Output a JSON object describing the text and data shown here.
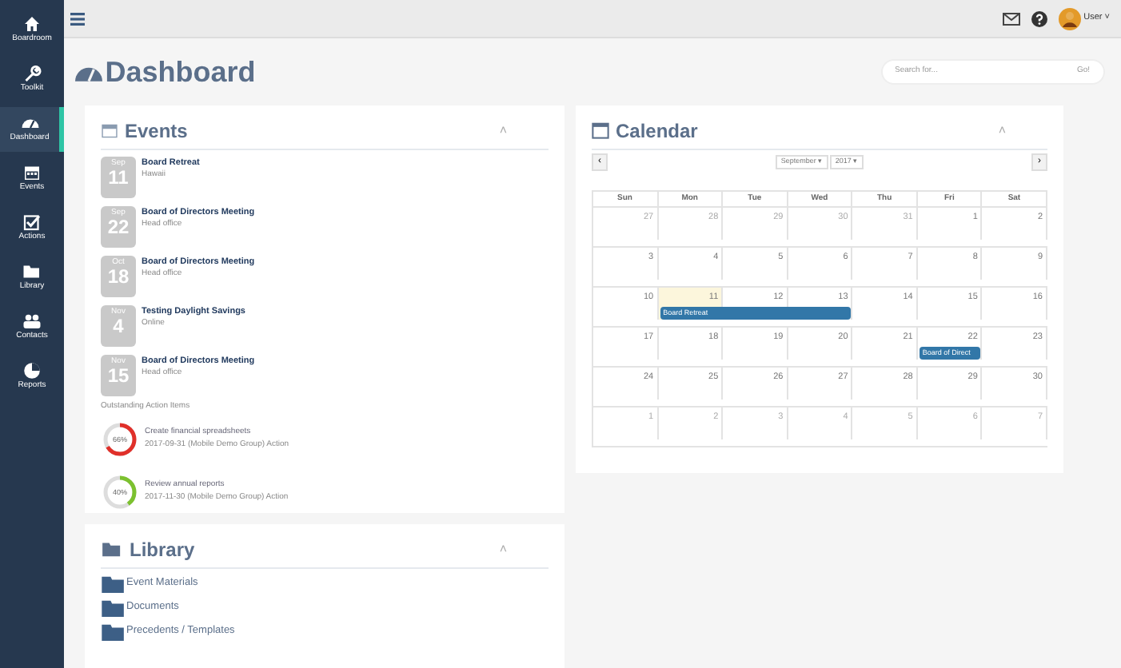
{
  "sidebar": {
    "items": [
      {
        "label": "Boardroom",
        "selected": false
      },
      {
        "label": "Toolkit",
        "selected": false
      },
      {
        "label": "Dashboard",
        "selected": true
      },
      {
        "label": "Events",
        "selected": false
      },
      {
        "label": "Actions",
        "selected": false
      },
      {
        "label": "Library",
        "selected": false
      },
      {
        "label": "Contacts",
        "selected": false
      },
      {
        "label": "Reports",
        "selected": false
      }
    ]
  },
  "topbar": {
    "user": "User",
    "caret": "˅"
  },
  "page": {
    "title": "Dashboard",
    "search": {
      "placeholder": "Search for...",
      "button": "Go!"
    }
  },
  "events": {
    "title": "Events",
    "collapse": "˄",
    "items": [
      {
        "month": "Sep",
        "day": "11",
        "title": "Board Retreat",
        "location": "Hawaii"
      },
      {
        "month": "Sep",
        "day": "22",
        "title": "Board of Directors Meeting",
        "location": "Head office"
      },
      {
        "month": "Oct",
        "day": "18",
        "title": "Board of Directors Meeting",
        "location": "Head office"
      },
      {
        "month": "Nov",
        "day": "4",
        "title": "Testing Daylight Savings",
        "location": "Online"
      },
      {
        "month": "Nov",
        "day": "15",
        "title": "Board of Directors Meeting",
        "location": "Head office"
      }
    ],
    "actions_heading": "Outstanding Action Items",
    "actions": [
      {
        "percent": "66%",
        "level": 0.66,
        "color": "#e0302a",
        "title": "Create financial spreadsheets",
        "detail": "2017-09-31 (Mobile Demo Group) Action"
      },
      {
        "percent": "40%",
        "level": 0.4,
        "color": "#7cc12f",
        "title": "Review annual reports",
        "detail": "2017-11-30 (Mobile Demo Group) Action"
      }
    ]
  },
  "calendar": {
    "title": "Calendar",
    "collapse": "˄",
    "prev": "‹",
    "next": "›",
    "month": "September ▾",
    "year": "2017 ▾",
    "weekdays": [
      "Sun",
      "Mon",
      "Tue",
      "Wed",
      "Thu",
      "Fri",
      "Sat"
    ],
    "weeks": [
      {
        "days": [
          {
            "n": "27",
            "outside": true,
            "today": false
          },
          {
            "n": "28",
            "outside": true,
            "today": false
          },
          {
            "n": "29",
            "outside": true,
            "today": false
          },
          {
            "n": "30",
            "outside": true,
            "today": false
          },
          {
            "n": "31",
            "outside": true,
            "today": false
          },
          {
            "n": "1",
            "outside": false,
            "today": false
          },
          {
            "n": "2",
            "outside": false,
            "today": false
          }
        ]
      },
      {
        "days": [
          {
            "n": "3",
            "outside": false,
            "today": false
          },
          {
            "n": "4",
            "outside": false,
            "today": false
          },
          {
            "n": "5",
            "outside": false,
            "today": false
          },
          {
            "n": "6",
            "outside": false,
            "today": false
          },
          {
            "n": "7",
            "outside": false,
            "today": false
          },
          {
            "n": "8",
            "outside": false,
            "today": false
          },
          {
            "n": "9",
            "outside": false,
            "today": false
          }
        ]
      },
      {
        "days": [
          {
            "n": "10",
            "outside": false,
            "today": false
          },
          {
            "n": "11",
            "outside": false,
            "today": true,
            "event": "Board Retreat"
          },
          {
            "n": "12",
            "outside": false,
            "today": false,
            "continues": true
          },
          {
            "n": "13",
            "outside": false,
            "today": false,
            "continues": true
          },
          {
            "n": "14",
            "outside": false,
            "today": false
          },
          {
            "n": "15",
            "outside": false,
            "today": false
          },
          {
            "n": "16",
            "outside": false,
            "today": false
          }
        ]
      },
      {
        "days": [
          {
            "n": "17",
            "outside": false,
            "today": false
          },
          {
            "n": "18",
            "outside": false,
            "today": false
          },
          {
            "n": "19",
            "outside": false,
            "today": false
          },
          {
            "n": "20",
            "outside": false,
            "today": false
          },
          {
            "n": "21",
            "outside": false,
            "today": false
          },
          {
            "n": "22",
            "outside": false,
            "today": false,
            "event": "Board of Direct"
          },
          {
            "n": "23",
            "outside": false,
            "today": false
          }
        ]
      },
      {
        "days": [
          {
            "n": "24",
            "outside": false,
            "today": false
          },
          {
            "n": "25",
            "outside": false,
            "today": false
          },
          {
            "n": "26",
            "outside": false,
            "today": false
          },
          {
            "n": "27",
            "outside": false,
            "today": false
          },
          {
            "n": "28",
            "outside": false,
            "today": false
          },
          {
            "n": "29",
            "outside": false,
            "today": false
          },
          {
            "n": "30",
            "outside": false,
            "today": false
          }
        ]
      },
      {
        "days": [
          {
            "n": "1",
            "outside": true,
            "today": false
          },
          {
            "n": "2",
            "outside": true,
            "today": false
          },
          {
            "n": "3",
            "outside": true,
            "today": false
          },
          {
            "n": "4",
            "outside": true,
            "today": false
          },
          {
            "n": "5",
            "outside": true,
            "today": false
          },
          {
            "n": "6",
            "outside": true,
            "today": false
          },
          {
            "n": "7",
            "outside": true,
            "today": false
          }
        ]
      }
    ]
  },
  "library": {
    "title": "Library",
    "collapse": "˄",
    "items": [
      "Event Materials",
      "Documents",
      "Precedents / Templates"
    ]
  }
}
